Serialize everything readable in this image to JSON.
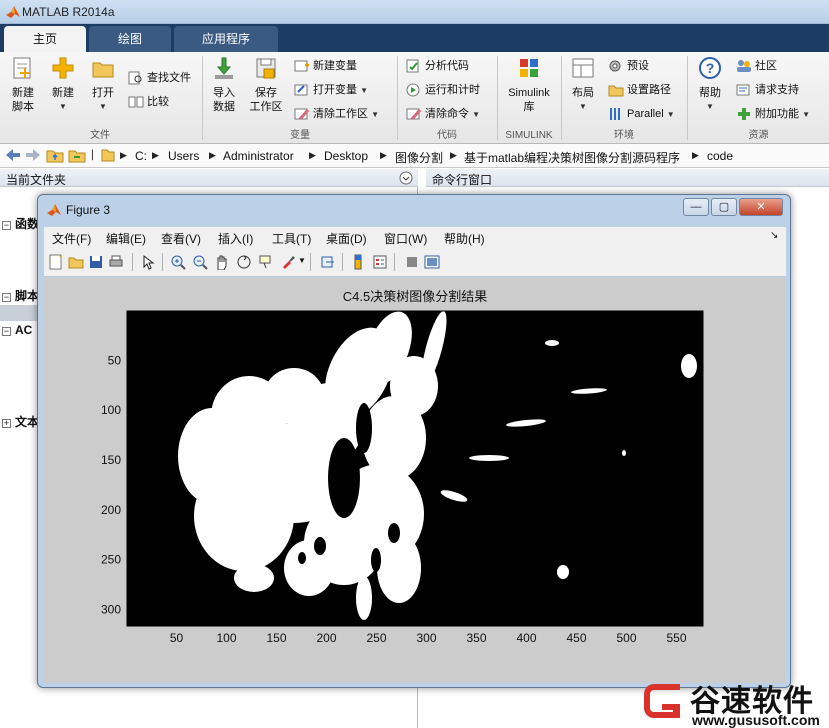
{
  "window": {
    "title": "MATLAB R2014a"
  },
  "ribbon": {
    "tabs": [
      {
        "label": "主页"
      },
      {
        "label": "绘图"
      },
      {
        "label": "应用程序"
      }
    ],
    "groups": [
      {
        "label": "文件"
      },
      {
        "label": "变量"
      },
      {
        "label": "代码"
      },
      {
        "label": "SIMULINK"
      },
      {
        "label": "环境"
      },
      {
        "label": "资源"
      }
    ],
    "file": {
      "new_script_1": "新建",
      "new_script_2": "脚本",
      "new": "新建",
      "open": "打开",
      "find_files": "查找文件",
      "compare": "比较"
    },
    "variable": {
      "import_1": "导入",
      "import_2": "数据",
      "save_1": "保存",
      "save_2": "工作区",
      "new_var": "新建变量",
      "open_var": "打开变量",
      "clear_ws": "清除工作区"
    },
    "code": {
      "analyze": "分析代码",
      "run_time": "运行和计时",
      "clear_cmd": "清除命令"
    },
    "simulink": {
      "lib_1": "Simulink",
      "lib_2": "库"
    },
    "env": {
      "layout": "布局",
      "prefs": "预设",
      "set_path": "设置路径",
      "parallel": "Parallel"
    },
    "resources": {
      "help": "帮助",
      "community": "社区",
      "support": "请求支持",
      "addons": "附加功能"
    }
  },
  "address": {
    "crumbs": [
      "C:",
      "Users",
      "Administrator",
      "Desktop",
      "图像分割",
      "基于matlab编程决策树图像分割源码程序",
      "code"
    ]
  },
  "left_panel": {
    "title": "当前文件夹",
    "sections": [
      {
        "label": "函数"
      },
      {
        "label": "脚本"
      },
      {
        "label": "AC"
      },
      {
        "label": "文本"
      }
    ]
  },
  "right_panel": {
    "title": "命令行窗口"
  },
  "figure": {
    "title": "Figure 3",
    "menu": [
      "文件(F)",
      "编辑(E)",
      "查看(V)",
      "插入(I)",
      "工具(T)",
      "桌面(D)",
      "窗口(W)",
      "帮助(H)"
    ],
    "plot_title": "C4.5决策树图像分割结果"
  },
  "chart_data": {
    "type": "heatmap",
    "title": "C4.5决策树图像分割结果",
    "xlabel": "",
    "ylabel": "",
    "xlim": [
      0.5,
      576.5
    ],
    "ylim": [
      0.5,
      316.5
    ],
    "x_ticks": [
      50,
      100,
      150,
      200,
      250,
      300,
      350,
      400,
      450,
      500,
      550
    ],
    "y_ticks": [
      50,
      100,
      150,
      200,
      250,
      300
    ],
    "y_reversed": true,
    "colormap": [
      "#000000",
      "#ffffff"
    ],
    "grid": false
  },
  "watermark": {
    "name": "谷速软件",
    "url": "www.gususoft.com"
  }
}
